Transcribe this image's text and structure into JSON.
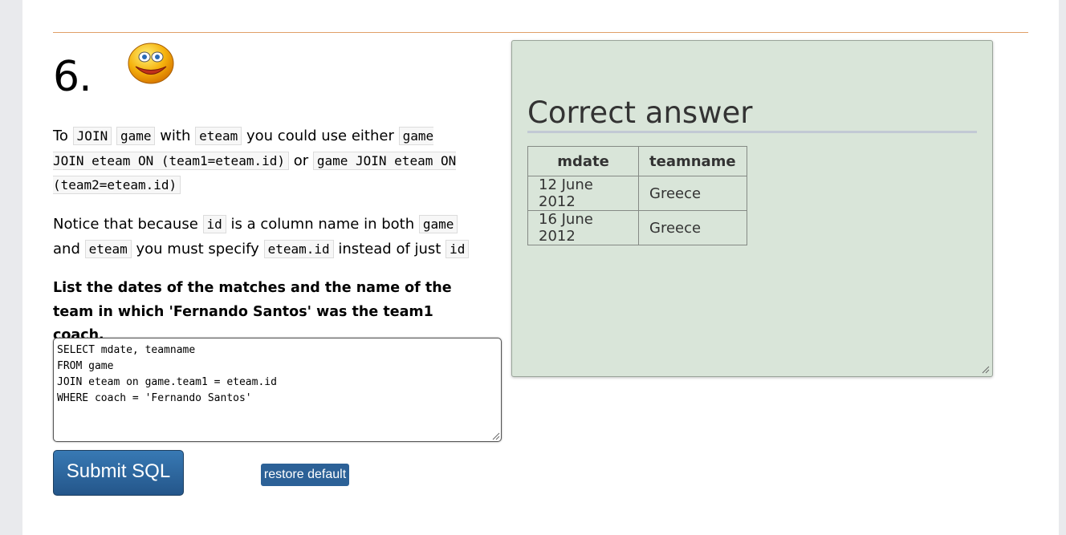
{
  "question": {
    "number": "6.",
    "smiley": "smiley-face-icon",
    "para1": {
      "t1": "To ",
      "code1": "JOIN",
      "code2": "game",
      "t2": " with ",
      "code3": "eteam",
      "t3": " you could use either ",
      "code4": "game JOIN eteam ON (team1=eteam.id)",
      "t4": " or ",
      "code5": "game JOIN eteam ON (team2=eteam.id)"
    },
    "para2": {
      "t1": "Notice that because ",
      "code1": "id",
      "t2": " is a column name in both ",
      "code2": "game",
      "t3": " and ",
      "code3": "eteam",
      "t4": " you must specify ",
      "code4": "eteam.id",
      "t5": " instead of just ",
      "code5": "id"
    },
    "task": "List the dates of the matches and the name of the team in which 'Fernando Santos' was the team1 coach."
  },
  "editor": {
    "sql": "SELECT mdate, teamname\nFROM game\nJOIN eteam on game.team1 = eteam.id\nWHERE coach = 'Fernando Santos'"
  },
  "buttons": {
    "submit": "Submit SQL",
    "restore": "restore default"
  },
  "answer": {
    "heading": "Correct answer",
    "columns": [
      "mdate",
      "teamname"
    ],
    "rows": [
      [
        "12 June 2012",
        "Greece"
      ],
      [
        "16 June 2012",
        "Greece"
      ]
    ]
  },
  "colors": {
    "answer_bg": "#d9e5d9",
    "submit_bg": "#2c6197",
    "rule": "#e0a068"
  }
}
